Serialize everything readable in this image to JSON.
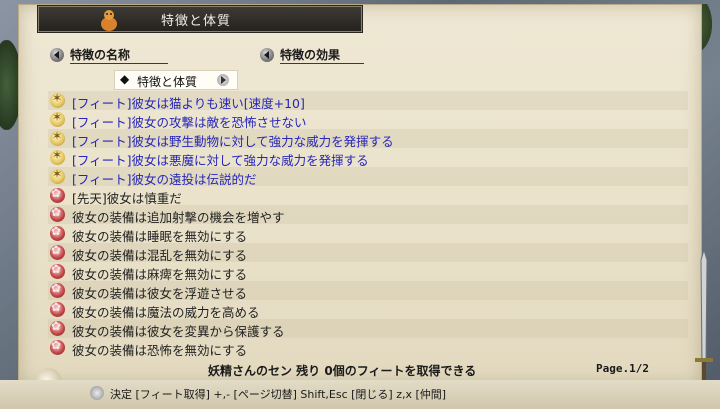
{
  "window": {
    "title": "特徴と体質"
  },
  "headers": {
    "name": "特徴の名称",
    "effect": "特徴の効果"
  },
  "category": {
    "label": "特徴と体質",
    "bullet": "◆"
  },
  "items": [
    {
      "icon": "sun-icon",
      "text": "[フィート]彼女は猫よりも速い[速度+10]",
      "color": "blue"
    },
    {
      "icon": "sun-icon",
      "text": "[フィート]彼女の攻撃は敵を恐怖させない",
      "color": "blue"
    },
    {
      "icon": "sun-icon",
      "text": "[フィート]彼女は野生動物に対して強力な威力を発揮する",
      "color": "blue"
    },
    {
      "icon": "sun-icon",
      "text": "[フィート]彼女は悪魔に対して強力な威力を発揮する",
      "color": "blue"
    },
    {
      "icon": "sun-icon",
      "text": "[フィート]彼女の遠投は伝説的だ",
      "color": "blue"
    },
    {
      "icon": "rose-icon",
      "text": "[先天]彼女は慎重だ",
      "color": "black"
    },
    {
      "icon": "rose-icon",
      "text": "彼女の装備は追加射撃の機会を増やす",
      "color": "black"
    },
    {
      "icon": "rose-icon",
      "text": "彼女の装備は睡眠を無効にする",
      "color": "black"
    },
    {
      "icon": "rose-icon",
      "text": "彼女の装備は混乱を無効にする",
      "color": "black"
    },
    {
      "icon": "rose-icon",
      "text": "彼女の装備は麻痺を無効にする",
      "color": "black"
    },
    {
      "icon": "rose-icon",
      "text": "彼女の装備は彼女を浮遊させる",
      "color": "black"
    },
    {
      "icon": "rose-icon",
      "text": "彼女の装備は魔法の威力を高める",
      "color": "black"
    },
    {
      "icon": "rose-icon",
      "text": "彼女の装備は彼女を変異から保護する",
      "color": "black"
    },
    {
      "icon": "rose-icon",
      "text": "彼女の装備は恐怖を無効にする",
      "color": "black"
    }
  ],
  "status": {
    "text": "妖精さんのセン 残り 0個のフィートを取得できる",
    "page": "Page.1/2"
  },
  "footer": {
    "hint": "決定 [フィート取得]  +,- [ページ切替]  Shift,Esc [閉じる]  z,x [仲間]"
  },
  "colors": {
    "blue_text": "#2626b8",
    "black_text": "#222222",
    "title_bg": "#2e2b27"
  }
}
